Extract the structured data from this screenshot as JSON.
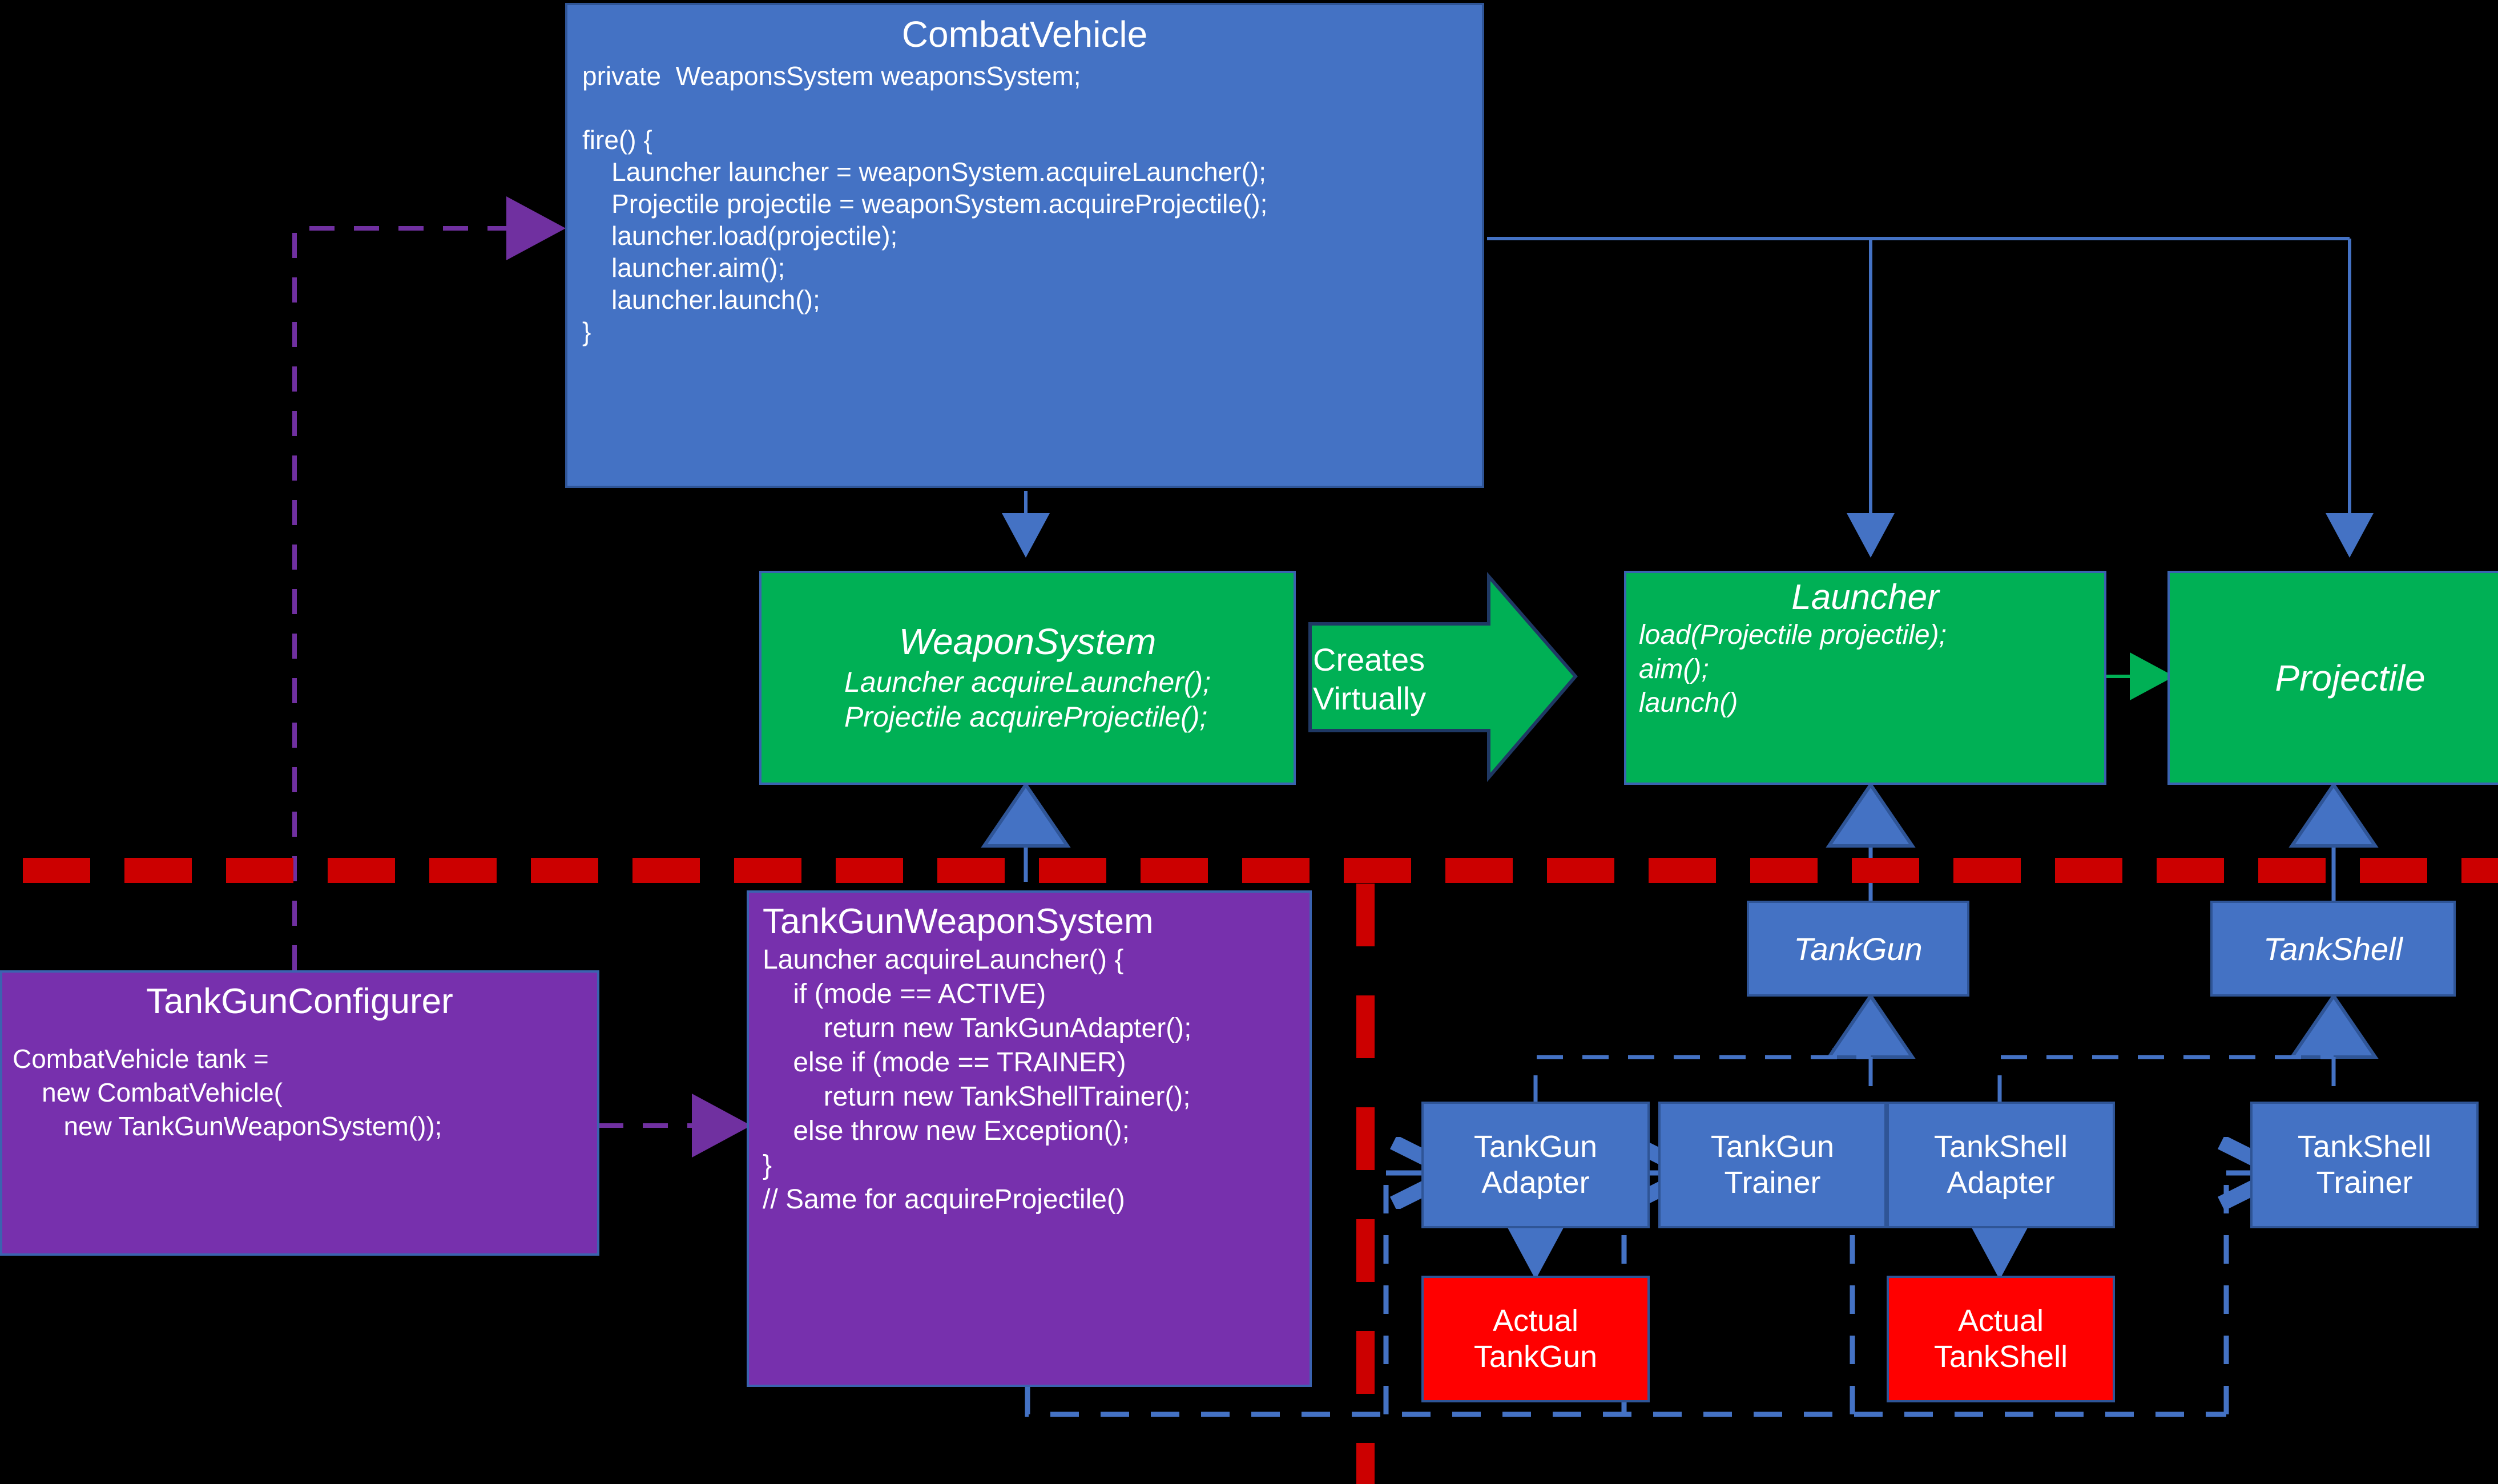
{
  "diagram": {
    "title": "Bridge / Abstract Factory weapon system design",
    "colors": {
      "blue_class": "#4472c4",
      "blue_border": "#2f5597",
      "green_interface": "#00b055",
      "purple_concrete": "#7730ad",
      "red_external": "#ff0000",
      "red_divider": "#cc0000",
      "purple_arrow": "#7030a0",
      "background": "#000000",
      "text": "#ffffff"
    }
  },
  "combat_vehicle": {
    "title": "CombatVehicle",
    "body": "private  WeaponsSystem weaponsSystem;\n\nfire() {\n    Launcher launcher = weaponSystem.acquireLauncher();\n    Projectile projectile = weaponSystem.acquireProjectile();\n    launcher.load(projectile);\n    launcher.aim();\n    launcher.launch();\n}"
  },
  "weapon_system": {
    "title": "WeaponSystem",
    "body": "Launcher acquireLauncher();\nProjectile acquireProjectile();"
  },
  "creates_virtually": {
    "line1": "Creates",
    "line2": "Virtually"
  },
  "launcher": {
    "title": "Launcher",
    "body": "load(Projectile projectile);\naim();\nlaunch()"
  },
  "projectile": {
    "title": "Projectile"
  },
  "tank_gun_configurer": {
    "title": "TankGunConfigurer",
    "body": "CombatVehicle tank =\n    new CombatVehicle(\n       new TankGunWeaponSystem());"
  },
  "tank_gun_weapon_system": {
    "title": "TankGunWeaponSystem",
    "body": "Launcher acquireLauncher() {\n    if (mode == ACTIVE)\n        return new TankGunAdapter();\n    else if (mode == TRAINER)\n        return new TankShellTrainer();\n    else throw new Exception();\n}\n// Same for acquireProjectile()"
  },
  "tank_gun": {
    "title": "TankGun"
  },
  "tank_shell": {
    "title": "TankShell"
  },
  "implementations": [
    {
      "id": "tank-gun-adapter",
      "line1": "TankGun",
      "line2": "Adapter"
    },
    {
      "id": "tank-gun-trainer",
      "line1": "TankGun",
      "line2": "Trainer"
    },
    {
      "id": "tank-shell-adapter",
      "line1": "TankShell",
      "line2": "Adapter"
    },
    {
      "id": "tank-shell-trainer",
      "line1": "TankShell",
      "line2": "Trainer"
    }
  ],
  "external_systems": [
    {
      "id": "actual-tank-gun",
      "line1": "Actual",
      "line2": "TankGun"
    },
    {
      "id": "actual-tank-shell",
      "line1": "Actual",
      "line2": "TankShell"
    }
  ]
}
